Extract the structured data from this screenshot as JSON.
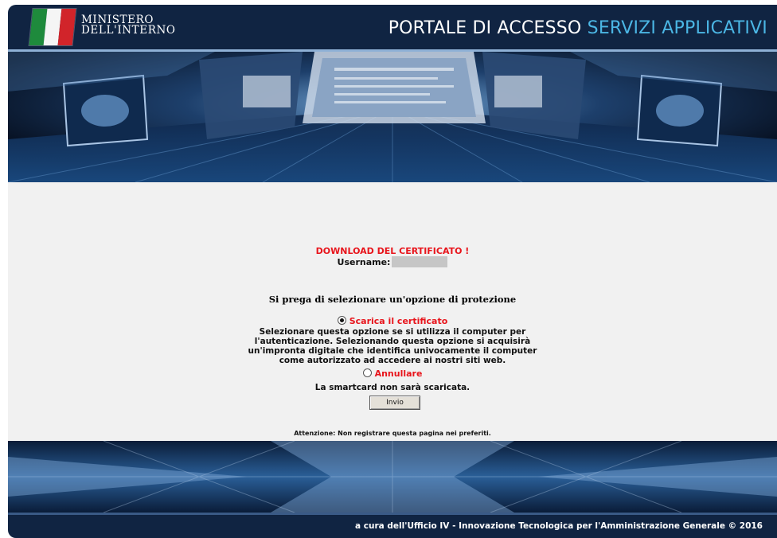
{
  "header": {
    "ministry_line1": "MINISTERO",
    "ministry_line2": "DELL'INTERNO",
    "portal_title_main": "PORTALE DI ACCESSO",
    "portal_title_accent": "SERVIZI APPLICATIVI",
    "flag_icon": "italian-flag-icon",
    "colors": {
      "bar": "#102442",
      "accent": "#4bb6e4"
    }
  },
  "main": {
    "download_title": "DOWNLOAD DEL CERTIFICATO  !",
    "username_label": "Username:",
    "prompt": "Si prega di selezionare un'opzione di protezione",
    "options": [
      {
        "label": "Scarica il certificato",
        "selected": true,
        "description_lines": [
          "Selezionare questa opzione se si utilizza il computer per",
          "l'autenticazione. Selezionando questa opzione si acquisirà",
          "un'impronta digitale che identifica univocamente il computer",
          "come autorizzato ad accedere ai nostri siti web."
        ]
      },
      {
        "label": "Annullare",
        "selected": false,
        "description": "La smartcard non sarà scaricata."
      }
    ],
    "submit_label": "Invio",
    "attention": "Attenzione: Non registrare questa pagina nei preferiti.",
    "colors": {
      "highlight": "#e8141b",
      "background": "#f1f1f1"
    }
  },
  "footer": {
    "text": "a cura dell'Ufficio IV - Innovazione Tecnologica per l'Amministrazione Generale  © 2016"
  }
}
